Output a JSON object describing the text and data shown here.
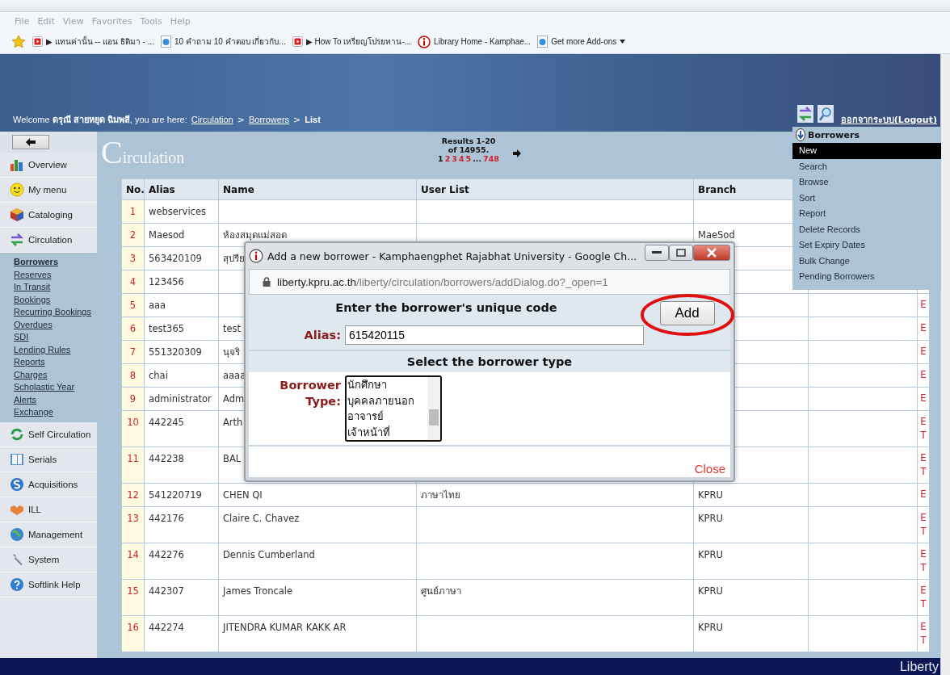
{
  "browser": {
    "menu": [
      "File",
      "Edit",
      "View",
      "Favorites",
      "Tools",
      "Help"
    ],
    "bookmarks": [
      {
        "kind": "video",
        "label": "▶ แทนค่านั้น -- แอน ธิติมา - ..."
      },
      {
        "kind": "page",
        "label": "10 คำถาม 10 คำตอบ เกี่ยวกับ..."
      },
      {
        "kind": "video",
        "label": "▶ How To เหรียญโปรยทาน-..."
      },
      {
        "kind": "info",
        "label": "Library Home - Kamphae..."
      },
      {
        "kind": "page",
        "label": "Get more Add-ons",
        "dropdown": true
      }
    ]
  },
  "header": {
    "welcome": "Welcome **ดรุณี สายหยุด ฉิมพลี**, you are here:",
    "breadcrumbs": [
      {
        "label": "Circulation",
        "link": true
      },
      {
        "label": "Borrowers",
        "link": true
      },
      {
        "label": "List",
        "link": false
      }
    ],
    "separator": ">",
    "logout": "ออกจากระบบ(Logout)"
  },
  "sidebar": {
    "modules": [
      {
        "label": "Overview"
      },
      {
        "label": "My menu"
      },
      {
        "label": "Cataloging"
      },
      {
        "label": "Circulation",
        "children": [
          {
            "label": "Borrowers",
            "selected": true
          },
          {
            "label": "Reserves",
            "selected": false
          },
          {
            "label": "In Transit",
            "selected": false
          },
          {
            "label": "Bookings",
            "selected": false
          },
          {
            "label": "Recurring Bookings",
            "selected": false
          },
          {
            "label": "Overdues",
            "selected": false
          },
          {
            "label": "SDI",
            "selected": false
          },
          {
            "label": "Lending Rules",
            "selected": false
          },
          {
            "label": "Reports",
            "selected": false
          },
          {
            "label": "Charges",
            "selected": false
          },
          {
            "label": "Scholastic Year",
            "selected": false
          },
          {
            "label": "Alerts",
            "selected": false
          },
          {
            "label": "Exchange",
            "selected": false
          }
        ]
      },
      {
        "label": "Self Circulation"
      },
      {
        "label": "Serials"
      },
      {
        "label": "Acquisitions"
      },
      {
        "label": "ILL"
      },
      {
        "label": "Management"
      },
      {
        "label": "System"
      },
      {
        "label": "Softlink Help"
      }
    ]
  },
  "content": {
    "title": "Circulation",
    "results": "Results 1-20 of 14955.",
    "pages": [
      {
        "kind": "page",
        "label": "1",
        "selected": true
      },
      {
        "kind": "page",
        "label": "2",
        "selected": false
      },
      {
        "kind": "page",
        "label": "3",
        "selected": false
      },
      {
        "kind": "page",
        "label": "4",
        "selected": false
      },
      {
        "kind": "page",
        "label": "5",
        "selected": false
      },
      {
        "kind": "gap",
        "label": "..."
      },
      {
        "kind": "page",
        "label": "748",
        "selected": false
      }
    ],
    "table": {
      "columns": [
        "No.",
        "Alias",
        "Name",
        "User List",
        "Branch"
      ],
      "rows": [
        {
          "no": "1",
          "alias": "webservices"
        },
        {
          "no": "2",
          "alias": "Maesod",
          "name": "ห้องสมุดแม่สอด",
          "branch": "MaeSod"
        },
        {
          "no": "3",
          "alias": "563420109",
          "name": "สุปรีย"
        },
        {
          "no": "4",
          "alias": "123456"
        },
        {
          "no": "5",
          "alias": "aaa",
          "actions": [
            "E"
          ]
        },
        {
          "no": "6",
          "alias": "test365",
          "name": "test",
          "actions": [
            "E"
          ]
        },
        {
          "no": "7",
          "alias": "551320309",
          "name": "นุจริ",
          "actions": [
            "E"
          ]
        },
        {
          "no": "8",
          "alias": "chai",
          "name": "aaaa",
          "actions": [
            "E"
          ]
        },
        {
          "no": "9",
          "alias": "administrator",
          "name": "Adm",
          "actions": [
            "E"
          ]
        },
        {
          "no": "10",
          "alias": "442245",
          "name": "Arth",
          "actions": [
            "E",
            "T"
          ]
        },
        {
          "no": "11",
          "alias": "442238",
          "name": "BAL",
          "actions": [
            "E",
            "T"
          ]
        },
        {
          "no": "12",
          "alias": "541220719",
          "name": "CHEN QI",
          "user_list": "ภาษาไทย",
          "branch": "KPRU",
          "actions": [
            "E"
          ]
        },
        {
          "no": "13",
          "alias": "442176",
          "name": "Claire C. Chavez",
          "branch": "KPRU",
          "actions": [
            "E",
            "T"
          ]
        },
        {
          "no": "14",
          "alias": "442276",
          "name": "Dennis Cumberland",
          "branch": "KPRU",
          "actions": [
            "E",
            "T"
          ]
        },
        {
          "no": "15",
          "alias": "442307",
          "name": "James Troncale",
          "user_list": "ศูนย์ภาษา",
          "branch": "KPRU",
          "actions": [
            "E",
            "T"
          ]
        },
        {
          "no": "16",
          "alias": "442274",
          "name": "JITENDRA KUMAR KAKK AR",
          "branch": "KPRU",
          "actions": [
            "E",
            "T"
          ]
        }
      ]
    }
  },
  "borrowers_menu": {
    "title": "Borrowers",
    "items": [
      {
        "label": "New",
        "selected": true
      },
      {
        "label": "Search",
        "selected": false
      },
      {
        "label": "Browse",
        "selected": false
      },
      {
        "label": "Sort",
        "selected": false
      },
      {
        "label": "Report",
        "selected": false
      },
      {
        "label": "Delete Records",
        "selected": false
      },
      {
        "label": "Set Expiry Dates",
        "selected": false
      },
      {
        "label": "Bulk Change",
        "selected": false
      },
      {
        "label": "Pending Borrowers",
        "selected": false
      }
    ]
  },
  "dialog": {
    "title": "Add a new borrower - Kamphaengphet Rajabhat University - Google Ch...",
    "url_host": "liberty.kpru.ac.th",
    "url_path": "/liberty/circulation/borrowers/addDialog.do?_open=1",
    "code_heading": "Enter the borrower's unique code",
    "alias_label": "Alias:",
    "alias_value": "615420115",
    "add": "Add",
    "type_heading": "Select the borrower type",
    "type_label": "Borrower Type:",
    "types": [
      "นักศึกษา",
      "บุคคลภายนอก",
      "อาจารย์",
      "เจ้าหน้าที่"
    ],
    "close": "Close"
  },
  "footer": {
    "brand": "Liberty"
  }
}
